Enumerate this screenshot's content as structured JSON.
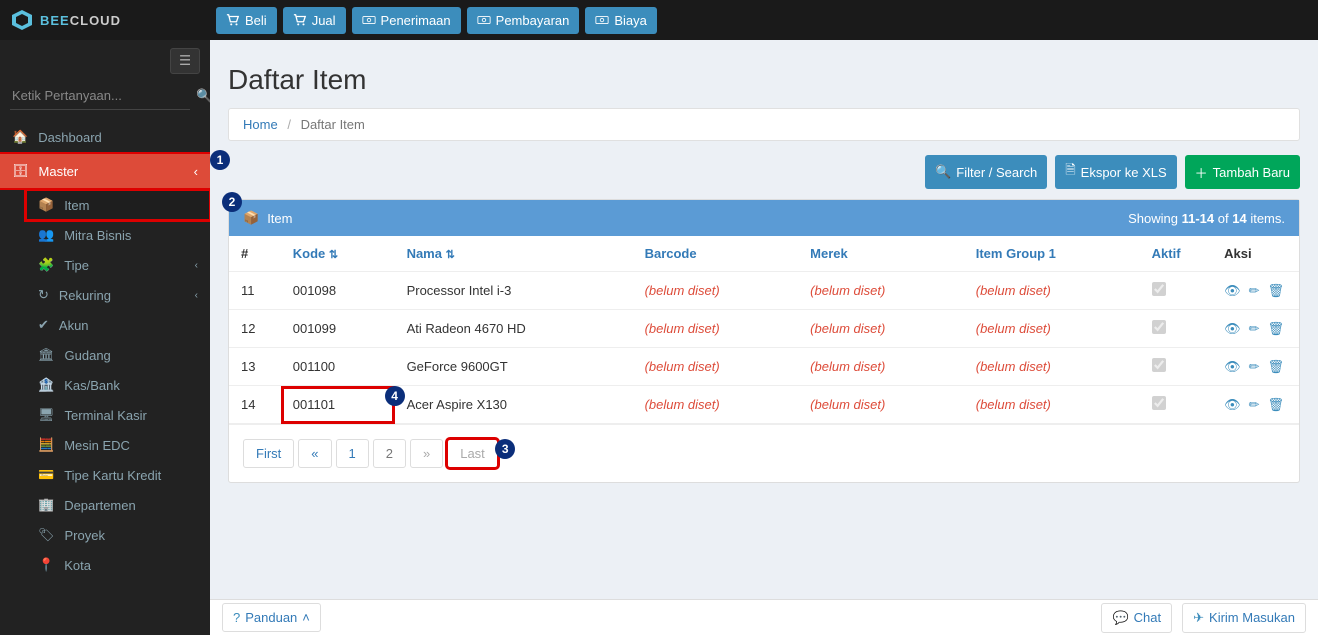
{
  "brand": {
    "bee": "BEE",
    "cloud": "CLOUD"
  },
  "topbuttons": {
    "beli": "Beli",
    "jual": "Jual",
    "penerimaan": "Penerimaan",
    "pembayaran": "Pembayaran",
    "biaya": "Biaya"
  },
  "sidebar": {
    "search_placeholder": "Ketik Pertanyaan...",
    "dashboard": "Dashboard",
    "master": "Master",
    "sub": {
      "item": "Item",
      "mitra": "Mitra Bisnis",
      "tipe": "Tipe",
      "rekuring": "Rekuring",
      "akun": "Akun",
      "gudang": "Gudang",
      "kasbank": "Kas/Bank",
      "terminal": "Terminal Kasir",
      "mesinedc": "Mesin EDC",
      "tipekartu": "Tipe Kartu Kredit",
      "departemen": "Departemen",
      "proyek": "Proyek",
      "kota": "Kota"
    }
  },
  "page": {
    "title": "Daftar Item",
    "breadcrumb_home": "Home",
    "breadcrumb_current": "Daftar Item"
  },
  "actions": {
    "filter": "Filter / Search",
    "ekspor": "Ekspor ke XLS",
    "tambah": "Tambah Baru"
  },
  "panel": {
    "title": "Item",
    "showing_prefix": "Showing ",
    "range": "11-14",
    "showing_mid": " of ",
    "total": "14",
    "showing_suffix": " items."
  },
  "columns": {
    "num": "#",
    "kode": "Kode",
    "nama": "Nama",
    "barcode": "Barcode",
    "merek": "Merek",
    "group": "Item Group 1",
    "aktif": "Aktif",
    "aksi": "Aksi"
  },
  "unset_label": "(belum diset)",
  "rows": [
    {
      "n": "11",
      "kode": "001098",
      "nama": "Processor Intel i-3"
    },
    {
      "n": "12",
      "kode": "001099",
      "nama": "Ati Radeon 4670 HD"
    },
    {
      "n": "13",
      "kode": "001100",
      "nama": "GeForce 9600GT"
    },
    {
      "n": "14",
      "kode": "001101",
      "nama": "Acer Aspire X130"
    }
  ],
  "pager": {
    "first": "First",
    "prev": "«",
    "p1": "1",
    "p2": "2",
    "next": "»",
    "last": "Last"
  },
  "footer": {
    "panduan": "Panduan",
    "chat": "Chat",
    "kirim": "Kirim Masukan"
  },
  "anno": {
    "a1": "1",
    "a2": "2",
    "a3": "3",
    "a4": "4"
  }
}
